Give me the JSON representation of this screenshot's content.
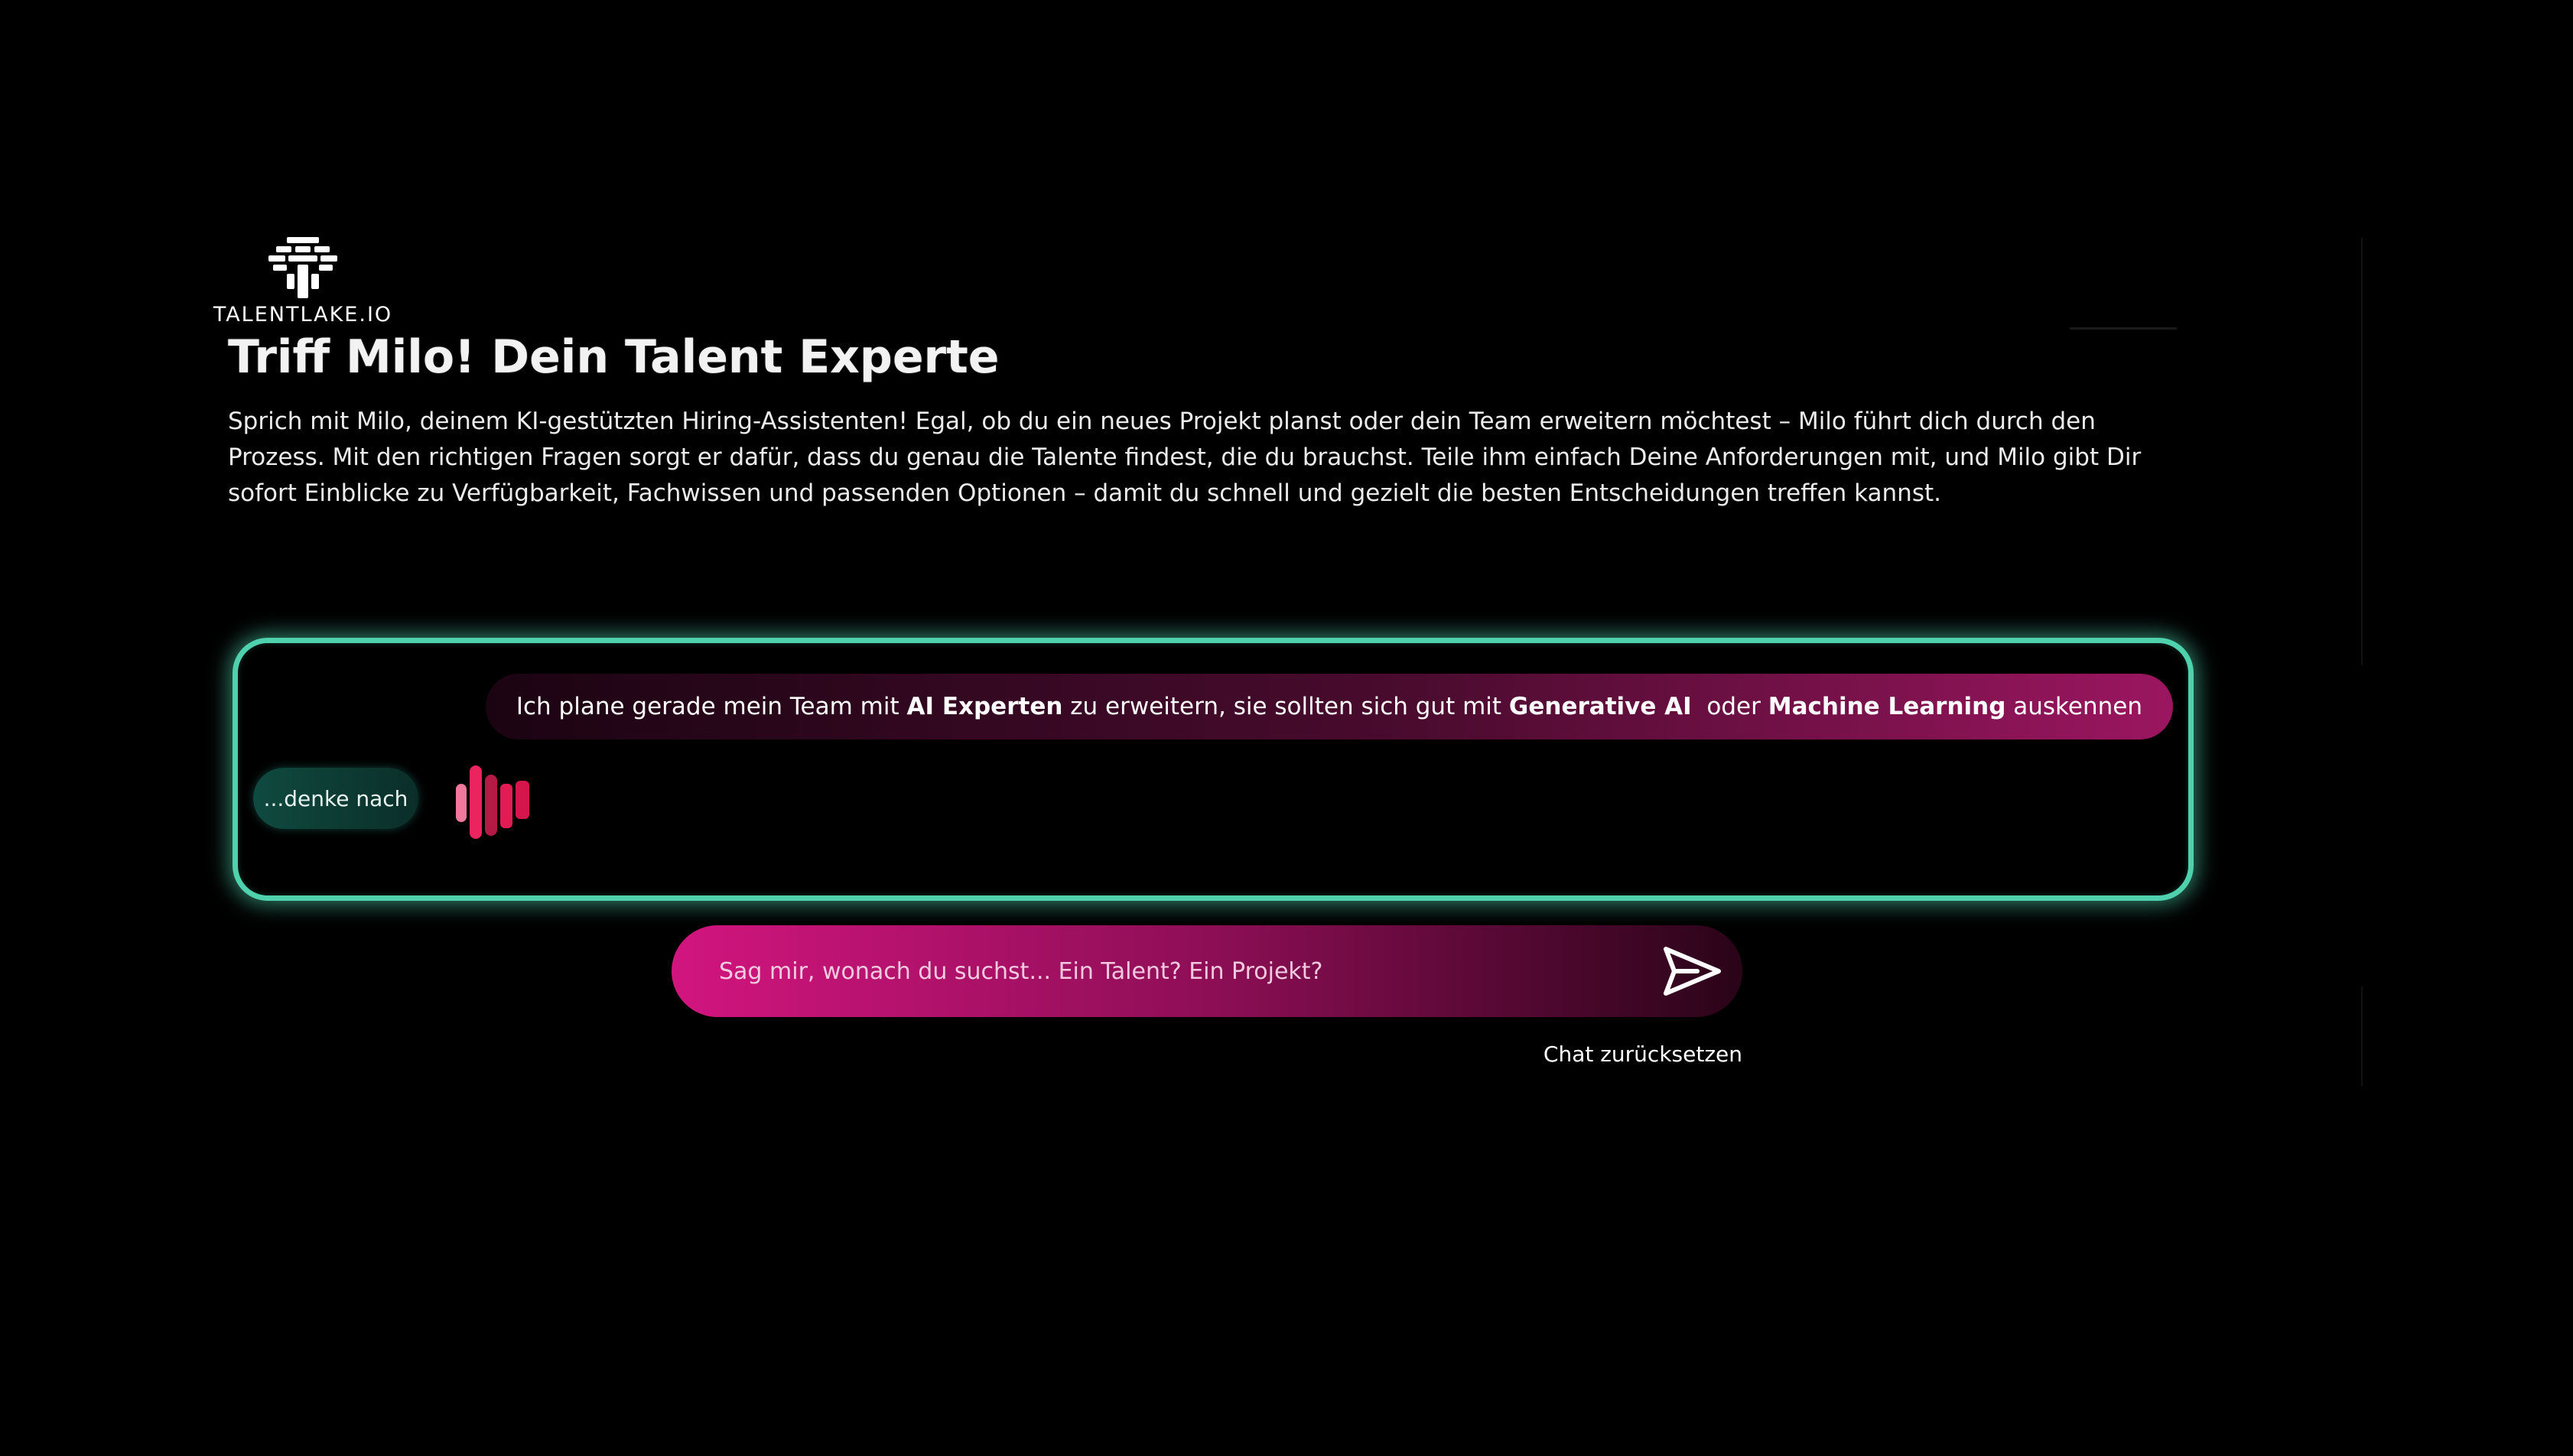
{
  "brand": {
    "name": "TALENTLAKE.IO",
    "logo_icon": "talentlake-logo-icon"
  },
  "hero": {
    "title": "Triff Milo! Dein Talent Experte",
    "intro": "Sprich mit Milo, deinem KI-gestützten Hiring-Assistenten! Egal, ob du ein neues Projekt planst oder dein Team erweitern möchtest – Milo führt dich durch den Prozess. Mit den richtigen Fragen sorgt er dafür, dass du genau die Talente findest, die du brauchst. Teile ihm einfach Deine Anforderungen mit, und Milo gibt Dir sofort Einblicke zu Verfügbarkeit, Fachwissen und passenden Optionen – damit du schnell und gezielt die besten Entscheidungen treffen kannst."
  },
  "chat": {
    "user_message": {
      "part1": "Ich plane gerade mein Team mit ",
      "bold1": "AI Experten",
      "part2": " zu erweitern, sie sollten sich gut mit ",
      "bold2": "Generative AI",
      "part3": "  oder ",
      "bold3": "Machine Learning",
      "part4": " auskennen"
    },
    "thinking_label": "...denke nach",
    "thinking_icon": "audio-bars-icon"
  },
  "input": {
    "placeholder": "Sag mir, wonach du suchst... Ein Talent? Ein Projekt?",
    "value": "",
    "send_icon": "send-icon"
  },
  "reset_label": "Chat zurücksetzen",
  "colors": {
    "background": "#000000",
    "accent_green": "#4fd1ad",
    "accent_pink": "#d2157f"
  }
}
